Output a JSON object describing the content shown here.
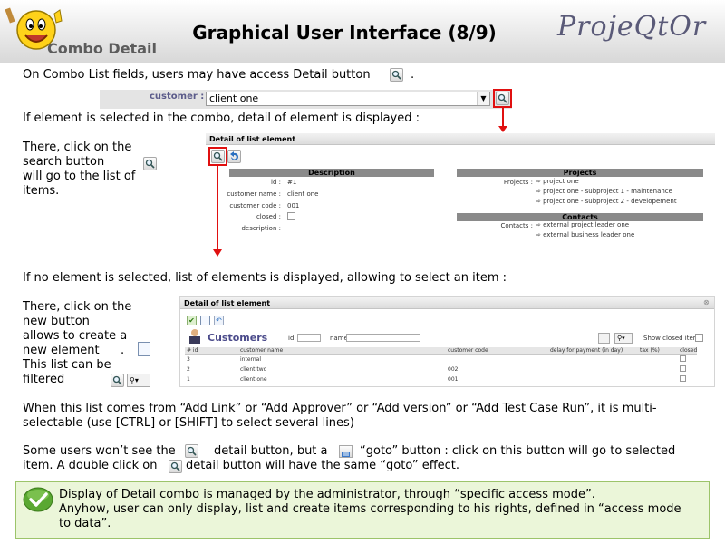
{
  "header": {
    "title": "Graphical User Interface (8/9)",
    "subtitle": "Combo Detail",
    "brand": "ProjeQtOr"
  },
  "text": {
    "l1": "On Combo List fields, users may have access Detail button",
    "l1_end": ".",
    "l2": "If element is selected in the combo, detail of element is displayed :",
    "there1": [
      "There,  click on the",
      "search button",
      "will go to the list of",
      "items."
    ],
    "l3": "If no element is selected, list of elements is displayed, allowing to select an item :",
    "there2": [
      "There, click on the",
      "new button",
      "allows to create a",
      "new element",
      "This list can be",
      "filtered"
    ],
    "there2_dot": ".",
    "p1": [
      "When this list comes from “Add Link” or “Add Approver” or “Add version” or “Add Test Case Run”, it is multi-",
      "selectable (use [CTRL] or [SHIFT] to select several lines)"
    ],
    "p2a": "Some users won’t see the",
    "p2b": "detail button, but a",
    "p2c": "“goto” button : click on this button will go to selected",
    "p2d": "item. A double click on",
    "p2e": "detail button will have the same “goto” effect."
  },
  "combo": {
    "label": "customer :",
    "value": "client one"
  },
  "panel1": {
    "title": "Detail of list element",
    "description_header": "Description",
    "fields": [
      {
        "label": "id :",
        "value": "#1"
      },
      {
        "label": "customer name :",
        "value": "client one"
      },
      {
        "label": "customer code :",
        "value": "001"
      },
      {
        "label": "closed :",
        "value": ""
      },
      {
        "label": "description :",
        "value": ""
      }
    ],
    "projects_header": "Projects",
    "projects_label": "Projects :",
    "projects": [
      "project one",
      "project one - subproject 1 - maintenance",
      "project one - subproject 2 - developement"
    ],
    "contacts_header": "Contacts",
    "contacts_label": "Contacts :",
    "contacts": [
      "external project leader one",
      "external business leader one"
    ]
  },
  "panel2": {
    "title": "Detail of list element",
    "list_title": "Customers",
    "filter_id_label": "id",
    "filter_name_label": "name",
    "show_closed_label": "Show closed items",
    "columns": [
      "# id",
      "customer name",
      "customer code",
      "delay for payment (in day)",
      "tax (%)",
      "closed"
    ],
    "rows": [
      [
        "3",
        "internal",
        "",
        "",
        "",
        ""
      ],
      [
        "2",
        "client two",
        "002",
        "",
        "",
        ""
      ],
      [
        "1",
        "client one",
        "001",
        "",
        "",
        ""
      ]
    ]
  },
  "info": {
    "lines": [
      "Display of Detail combo is managed by the administrator, through “specific access mode”.",
      "Anyhow, user can only display, list and create items corresponding to his rights, defined in “access mode",
      "to data”."
    ]
  },
  "colors": {
    "highlight": "#e01010",
    "info_bg": "#ebf6d9",
    "section_header": "#8a8a8a"
  }
}
